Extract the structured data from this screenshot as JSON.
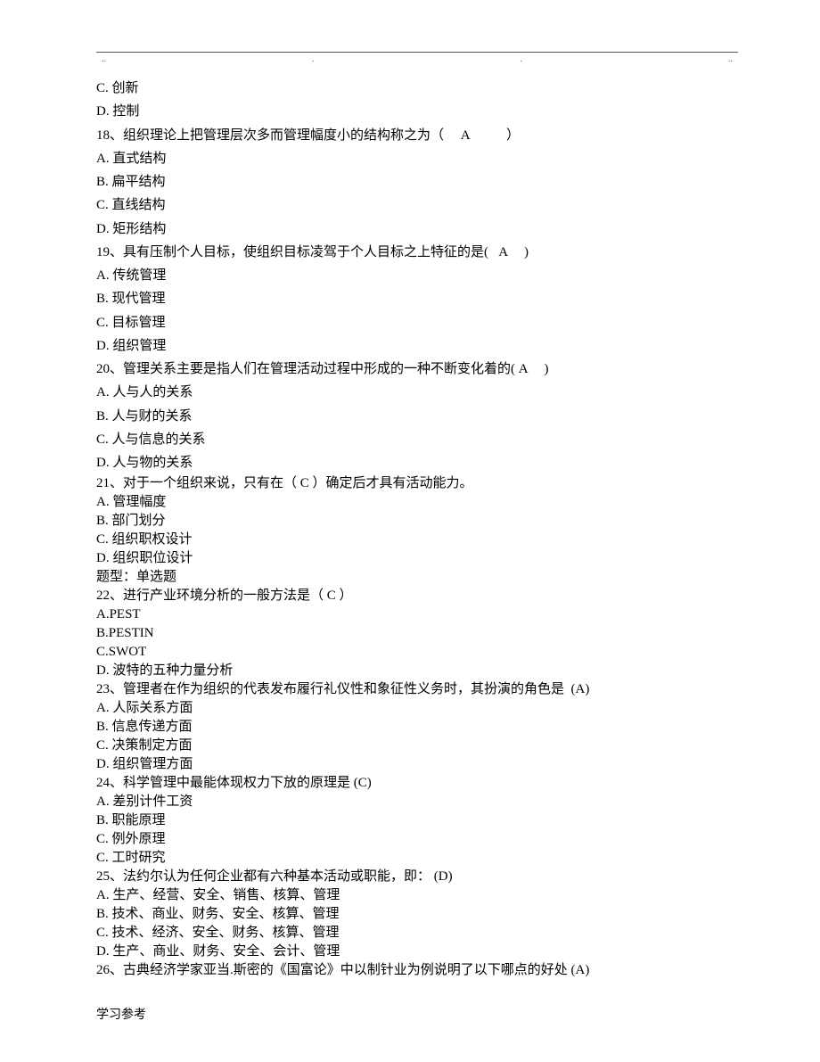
{
  "header_marks": [
    "..",
    ".",
    ".",
    ".."
  ],
  "lines_spaced": [
    "C. 创新",
    "D. 控制",
    "18、组织理论上把管理层次多而管理幅度小的结构称之为（     A           ）",
    "A. 直式结构",
    "B. 扁平结构",
    "C. 直线结构",
    "D. 矩形结构",
    "19、具有压制个人目标，使组织目标凌驾于个人目标之上特征的是(   A     )",
    "A. 传统管理",
    "B. 现代管理",
    "C. 目标管理",
    "D. 组织管理",
    "20、管理关系主要是指人们在管理活动过程中形成的一种不断变化着的( A     )",
    "A. 人与人的关系",
    "B. 人与财的关系",
    "C. 人与信息的关系",
    "D. 人与物的关系"
  ],
  "lines_tight": [
    "21、对于一个组织来说，只有在（ C ）确定后才具有活动能力。",
    "A. 管理幅度",
    "B. 部门划分",
    "C. 组织职权设计",
    "D. 组织职位设计",
    "题型：单选题",
    "22、进行产业环境分析的一般方法是（ C ）",
    "A.PEST",
    "B.PESTIN",
    "C.SWOT",
    "D. 波特的五种力量分析",
    "23、管理者在作为组织的代表发布履行礼仪性和象征性义务时，其扮演的角色是  (A)",
    "A. 人际关系方面",
    "B. 信息传递方面",
    "C. 决策制定方面",
    "D. 组织管理方面",
    "24、科学管理中最能体现权力下放的原理是 (C)",
    "A. 差别计件工资",
    "B. 职能原理",
    "C. 例外原理",
    "C. 工时研究",
    "25、法约尔认为任何企业都有六种基本活动或职能，即： (D)",
    "A. 生产、经营、安全、销售、核算、管理",
    "B. 技术、商业、财务、安全、核算、管理",
    "C. 技术、经济、安全、财务、核算、管理",
    "D. 生产、商业、财务、安全、会计、管理",
    "26、古典经济学家亚当.斯密的《国富论》中以制针业为例说明了以下哪点的好处 (A)"
  ],
  "footer": "学习参考"
}
